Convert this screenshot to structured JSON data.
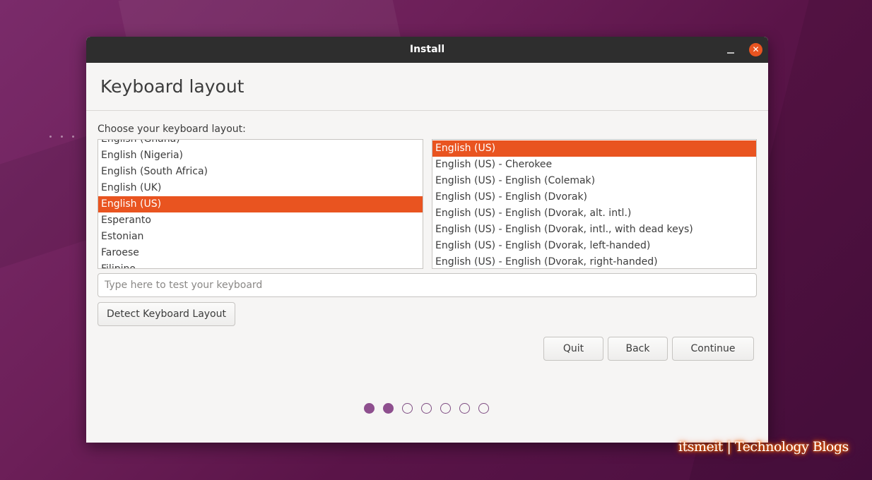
{
  "window": {
    "title": "Install"
  },
  "page": {
    "heading": "Keyboard layout",
    "choose_label": "Choose your keyboard layout:"
  },
  "layouts": {
    "items": [
      {
        "label": "English (Ghana)",
        "selected": false
      },
      {
        "label": "English (Nigeria)",
        "selected": false
      },
      {
        "label": "English (South Africa)",
        "selected": false
      },
      {
        "label": "English (UK)",
        "selected": false
      },
      {
        "label": "English (US)",
        "selected": true
      },
      {
        "label": "Esperanto",
        "selected": false
      },
      {
        "label": "Estonian",
        "selected": false
      },
      {
        "label": "Faroese",
        "selected": false
      },
      {
        "label": "Filipino",
        "selected": false
      }
    ]
  },
  "variants": {
    "items": [
      {
        "label": "English (US)",
        "selected": true
      },
      {
        "label": "English (US) - Cherokee",
        "selected": false
      },
      {
        "label": "English (US) - English (Colemak)",
        "selected": false
      },
      {
        "label": "English (US) - English (Dvorak)",
        "selected": false
      },
      {
        "label": "English (US) - English (Dvorak, alt. intl.)",
        "selected": false
      },
      {
        "label": "English (US) - English (Dvorak, intl., with dead keys)",
        "selected": false
      },
      {
        "label": "English (US) - English (Dvorak, left-handed)",
        "selected": false
      },
      {
        "label": "English (US) - English (Dvorak, right-handed)",
        "selected": false
      }
    ]
  },
  "test_input": {
    "value": "",
    "placeholder": "Type here to test your keyboard"
  },
  "buttons": {
    "detect": "Detect Keyboard Layout",
    "quit": "Quit",
    "back": "Back",
    "continue": "Continue"
  },
  "progress": {
    "total_steps": 7,
    "completed_steps": 2
  },
  "icons": {
    "minimize": "minimize-icon",
    "close": "close-icon"
  },
  "colors": {
    "accent": "#e95420",
    "progress": "#8e4f8e",
    "titlebar": "#2e2e2e"
  },
  "watermark": {
    "text": "itsmeit | Technology Blogs"
  }
}
